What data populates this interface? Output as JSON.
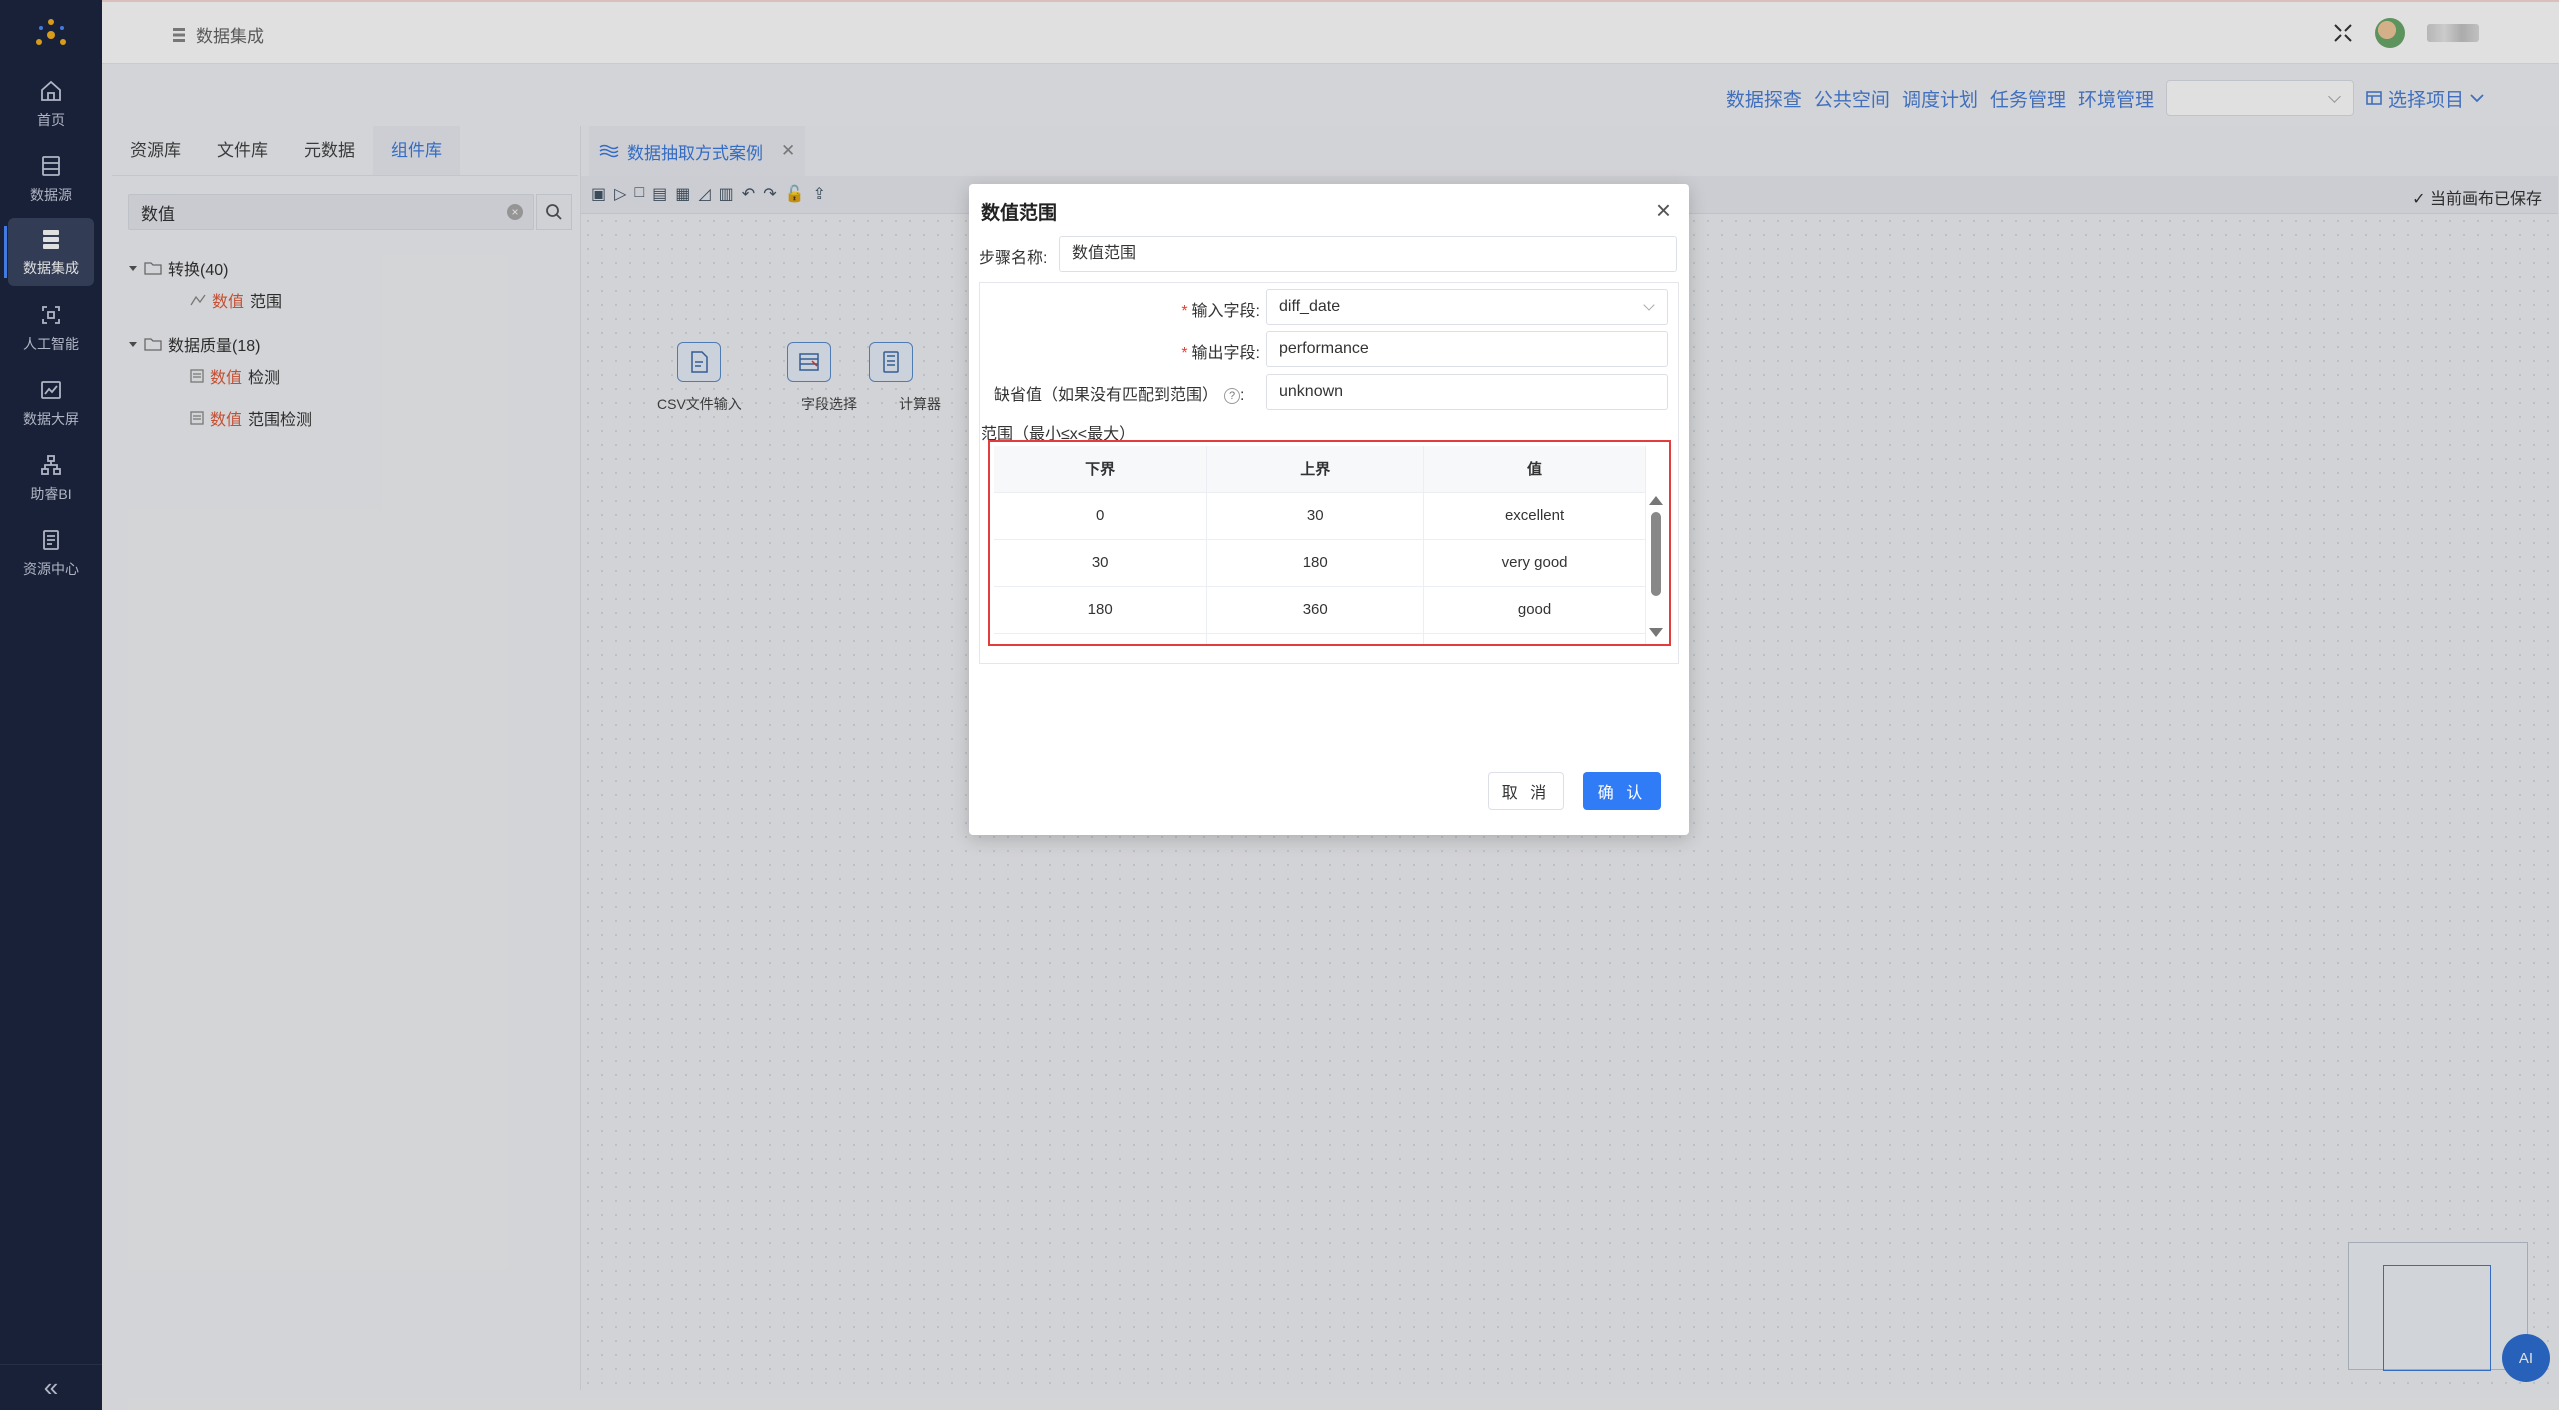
{
  "sidebar": {
    "items": [
      {
        "label": "首页",
        "icon": "home-icon"
      },
      {
        "label": "数据源",
        "icon": "database-icon"
      },
      {
        "label": "数据集成",
        "icon": "integration-icon",
        "active": true
      },
      {
        "label": "人工智能",
        "icon": "ai-icon"
      },
      {
        "label": "数据大屏",
        "icon": "chart-screen-icon"
      },
      {
        "label": "助睿BI",
        "icon": "bi-icon"
      },
      {
        "label": "资源中心",
        "icon": "resource-icon"
      }
    ],
    "collapse_label": "«"
  },
  "topbar": {
    "breadcrumb": "数据集成"
  },
  "projnav": {
    "links": [
      "数据探查",
      "公共空间",
      "调度计划",
      "任务管理",
      "环境管理"
    ],
    "select_value": "",
    "choose_project": "选择项目"
  },
  "leftpanel": {
    "tabs": [
      "资源库",
      "文件库",
      "元数据",
      "组件库"
    ],
    "active_tab": 3,
    "search_value": "数值",
    "tree": {
      "group1": "转换(40)",
      "group1_item_hl": "数值",
      "group1_item_rest": "范围",
      "group2": "数据质量(18)",
      "group2_item1_hl": "数值",
      "group2_item1_rest": "检测",
      "group2_item2_hl": "数值",
      "group2_item2_rest": "范围检测"
    }
  },
  "canvas": {
    "file_tab": "数据抽取方式案例",
    "saved_status": "当前画布已保存",
    "nodes": [
      {
        "label": "CSV文件输入"
      },
      {
        "label": "字段选择"
      },
      {
        "label": "计算器"
      }
    ],
    "ai_label": "AI"
  },
  "dialog": {
    "title": "数值范围",
    "step_name_label": "步骤名称:",
    "step_name_value": "数值范围",
    "input_field_label": "输入字段:",
    "input_field_value": "diff_date",
    "output_field_label": "输出字段:",
    "output_field_value": "performance",
    "default_label": "缺省值（如果没有匹配到范围）",
    "default_value": "unknown",
    "range_label": "范围（最小≤x<最大）",
    "table": {
      "headers": [
        "下界",
        "上界",
        "值"
      ],
      "rows": [
        [
          "0",
          "30",
          "excellent"
        ],
        [
          "30",
          "180",
          "very good"
        ],
        [
          "180",
          "360",
          "good"
        ]
      ]
    },
    "cancel": "取 消",
    "ok": "确 认"
  }
}
